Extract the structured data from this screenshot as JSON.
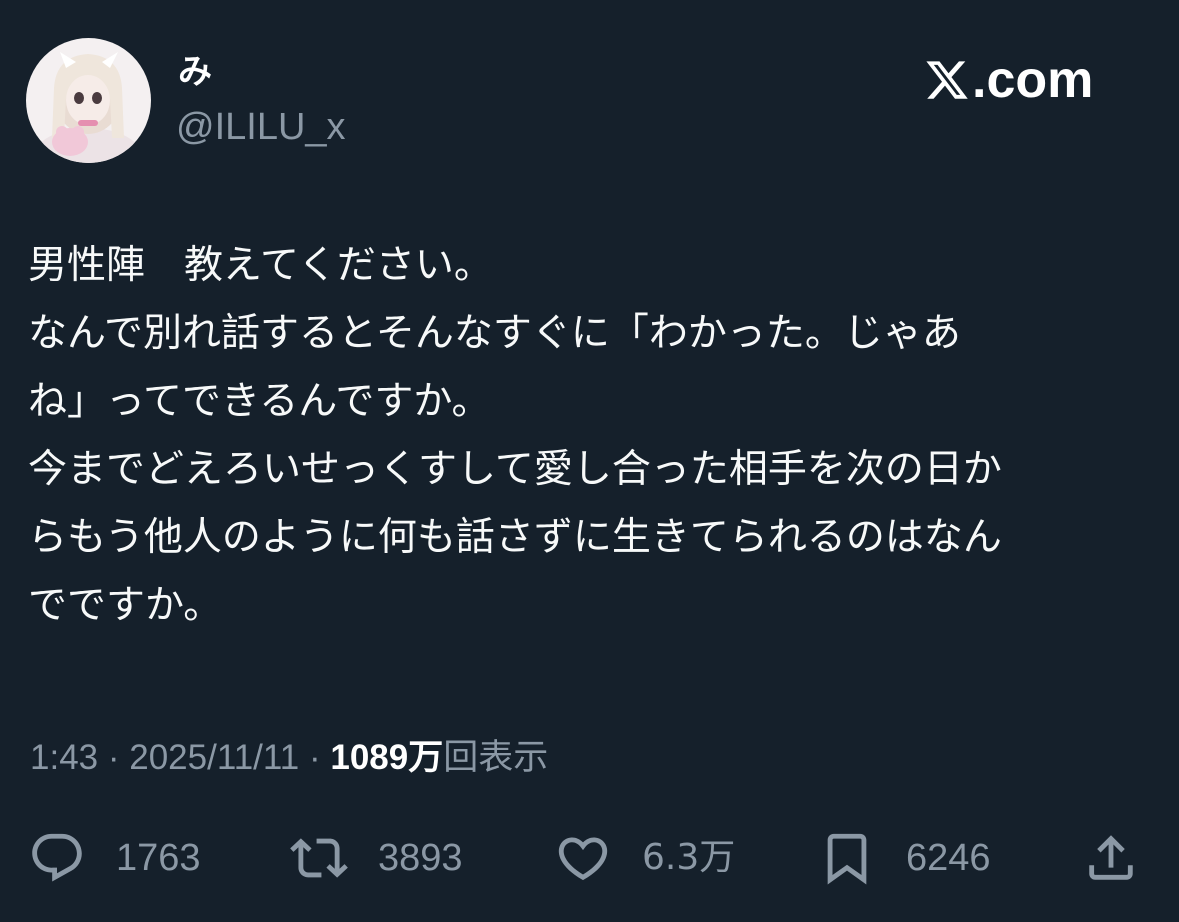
{
  "author": {
    "display_name": "み",
    "handle": "@ILILU_x"
  },
  "brand": {
    "label": ".com",
    "icon": "x-logo-icon"
  },
  "post": {
    "lines": [
      "男性陣　教えてください。",
      "なんで別れ話するとそんなすぐに「わかった。じゃあ",
      "ね」ってできるんですか。",
      "今までどえろいせっくすして愛し合った相手を次の日か",
      "らもう他人のように何も話さずに生きてられるのはなん",
      "でですか。"
    ]
  },
  "meta": {
    "time": "1:43",
    "sep1": "·",
    "date": "2025/11/11",
    "sep2": "·",
    "views_count": "1089",
    "views_unit": "万",
    "views_label": "回表示"
  },
  "actions": {
    "reply": {
      "icon": "reply-icon",
      "count": "1763"
    },
    "repost": {
      "icon": "repost-icon",
      "count": "3893"
    },
    "like": {
      "icon": "like-icon",
      "count": "6.3万"
    },
    "bookmark": {
      "icon": "bookmark-icon",
      "count": "6246"
    },
    "share": {
      "icon": "share-icon"
    }
  },
  "colors": {
    "background": "#15202b",
    "text": "#ffffff",
    "muted": "#8b98a5"
  }
}
